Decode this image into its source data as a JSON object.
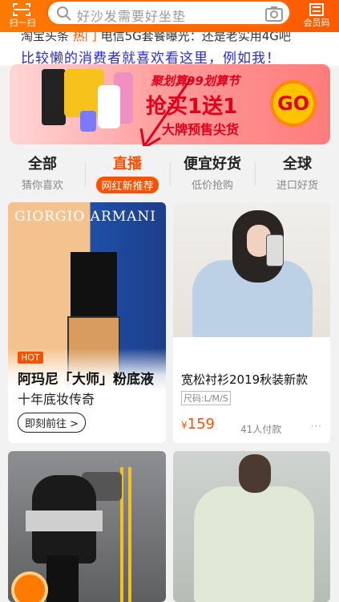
{
  "header": {
    "scan_label": "扫一扫",
    "search_placeholder": "好沙发需要好坐垫",
    "member_label": "会员码"
  },
  "promo_strip": {
    "left_text": "淘宝头条",
    "highlight": "热门",
    "right_text": "电信5G套餐曝光：还是老实用4G吧"
  },
  "annotation": "比较懒的消费者就喜欢看这里，例如我！",
  "banner": {
    "tagline": "聚划算99划算节",
    "headline": "抢买1送1",
    "subline": "大牌预售尖货",
    "go_label": "GO"
  },
  "tabs": [
    {
      "title": "全部",
      "subtitle": "猜你喜欢"
    },
    {
      "title": "直播",
      "subtitle": "网红新推荐"
    },
    {
      "title": "便宜好货",
      "subtitle": "低价抢购"
    },
    {
      "title": "全球",
      "subtitle": "进口好货"
    }
  ],
  "cards": {
    "armani": {
      "brand": "GIORGIO ARMANI",
      "badge": "HOT",
      "headline": "阿玛尼「大师」粉底液",
      "sub": "十年底妆传奇",
      "cta": "即刻前往 >"
    },
    "shirt": {
      "title": "宽松衬衫2019秋装新款",
      "tag": "尺码:L/M/S",
      "currency": "¥",
      "price": "159",
      "paid": "41人付款",
      "more": "···"
    }
  },
  "colors": {
    "brand_orange": "#ff5000",
    "header": "#ff6a00",
    "annotation": "#2b2bd6"
  }
}
